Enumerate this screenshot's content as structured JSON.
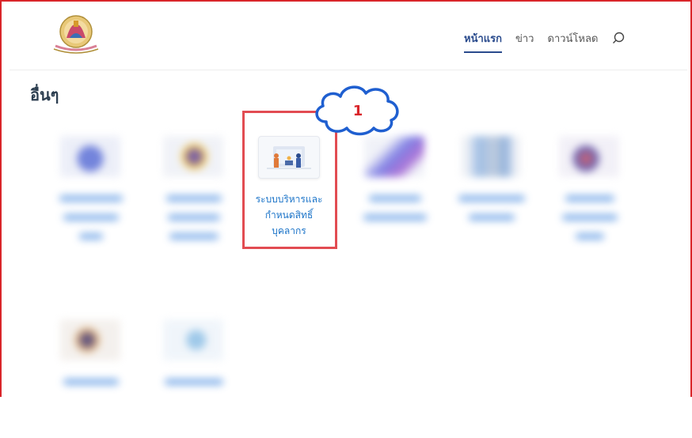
{
  "header": {
    "nav": [
      {
        "label": "หน้าแรก",
        "active": true
      },
      {
        "label": "ข่าว",
        "active": false
      },
      {
        "label": "ดาวน์โหลด",
        "active": false
      }
    ],
    "search_icon": "search-icon"
  },
  "page": {
    "title": "อื่นๆ"
  },
  "cards": {
    "active": {
      "label_line1": "ระบบบริหารและ",
      "label_line2": "กำหนดสิทธิ์",
      "label_line3": "บุคลากร"
    }
  },
  "annotation": {
    "step_number": "1"
  },
  "colors": {
    "accent": "#2a4b8d",
    "link": "#1a73c8",
    "highlight": "#e24c52",
    "frame": "#d9252a"
  }
}
